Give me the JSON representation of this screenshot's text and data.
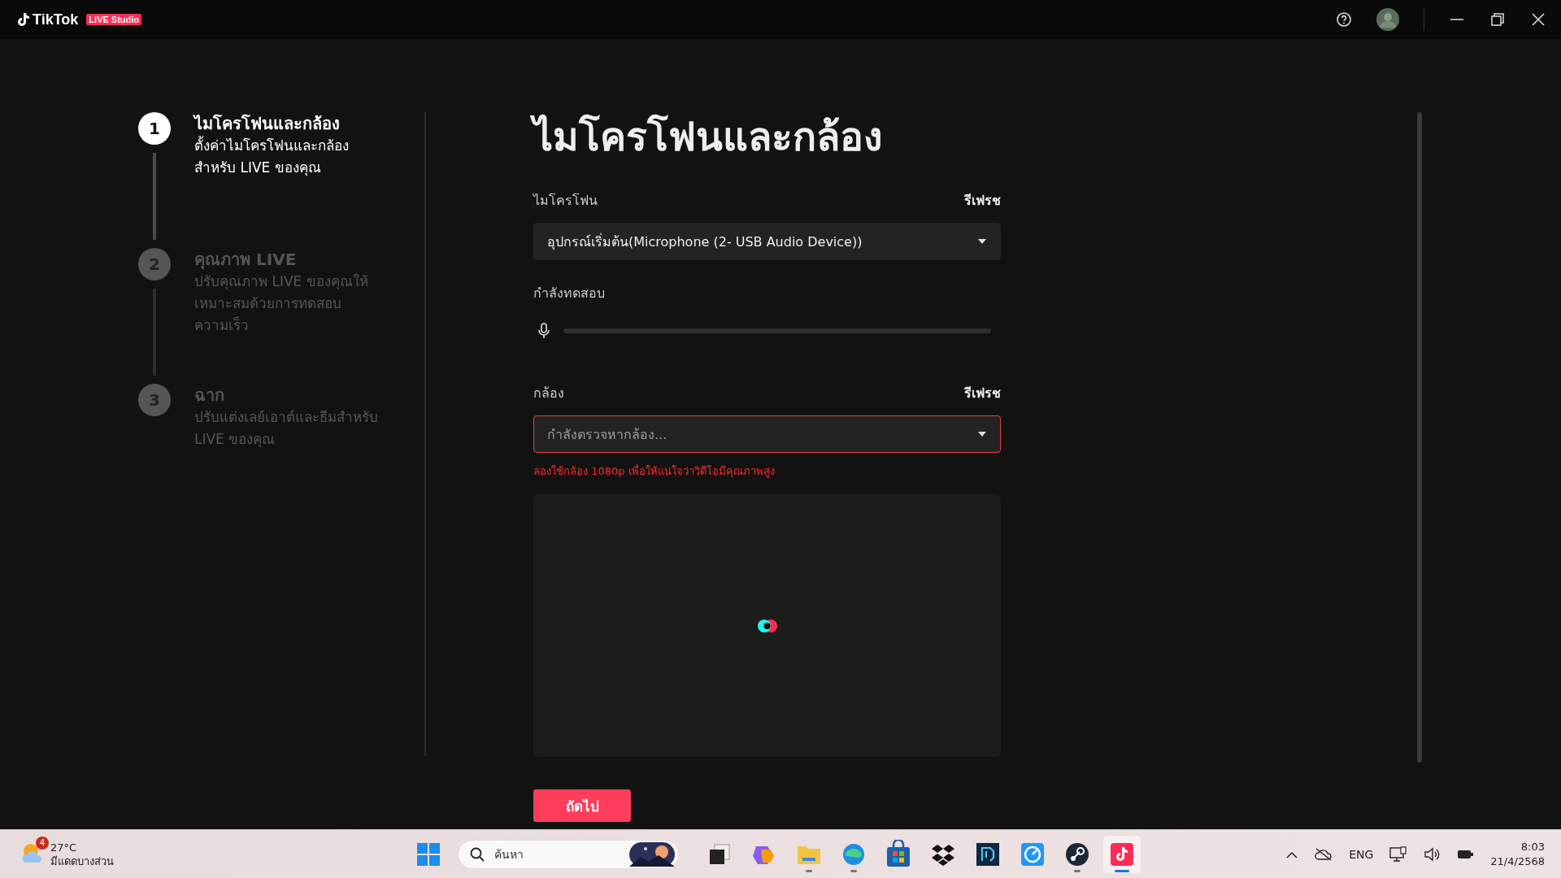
{
  "app_bar": {
    "logo": "TikTok",
    "badge": "LIVE Studio"
  },
  "steps": [
    {
      "number": "1",
      "title": "ไมโครโฟนและกล้อง",
      "description": "ตั้งค่าไมโครโฟนและกล้องสำหรับ LIVE ของคุณ",
      "active": true
    },
    {
      "number": "2",
      "title": "คุณภาพ LIVE",
      "description": "ปรับคุณภาพ LIVE ของคุณให้เหมาะสมด้วยการทดสอบความเร็ว",
      "active": false
    },
    {
      "number": "3",
      "title": "ฉาก",
      "description": "ปรับแต่งเลย์เอาต์และธีมสำหรับ LIVE ของคุณ",
      "active": false
    }
  ],
  "page_title": "ไมโครโฟนและกล้อง",
  "microphone": {
    "label": "ไมโครโฟน",
    "refresh": "รีเฟรช",
    "value": "อุปกรณ์เริ่มต้น(Microphone (2- USB Audio Device))",
    "error": false
  },
  "mic_test": {
    "label": "กำลังทดสอบ",
    "level": 0
  },
  "camera": {
    "label": "กล้อง",
    "refresh": "รีเฟรช",
    "placeholder": "กำลังตรวจหากล้อง...",
    "error": true,
    "hint": "ลองใช้กล้อง 1080p เพื่อให้แน่ใจว่าวิดีโอมีคุณภาพสูง"
  },
  "next_button": "ถัดไป",
  "taskbar": {
    "weather": {
      "badge": "4",
      "temperature": "27°C",
      "condition": "มีแดดบางส่วน"
    },
    "search": {
      "placeholder": "ค้นหา"
    },
    "apps": [
      {
        "kind": "start",
        "running": false,
        "active": false
      },
      {
        "kind": "taskview",
        "running": false,
        "active": false
      },
      {
        "kind": "copilot",
        "running": false,
        "active": false
      },
      {
        "kind": "folder",
        "running": true,
        "active": false
      },
      {
        "kind": "edge",
        "running": true,
        "active": false
      },
      {
        "kind": "store",
        "running": false,
        "active": false
      },
      {
        "kind": "dropbox",
        "running": false,
        "active": false
      },
      {
        "kind": "bluebox",
        "running": false,
        "active": false
      },
      {
        "kind": "gauge",
        "running": false,
        "active": false
      },
      {
        "kind": "steam",
        "running": true,
        "active": false
      },
      {
        "kind": "tiktok",
        "running": true,
        "active": true
      }
    ],
    "language": "ENG",
    "time": "8:03",
    "date": "21/4/2568"
  }
}
